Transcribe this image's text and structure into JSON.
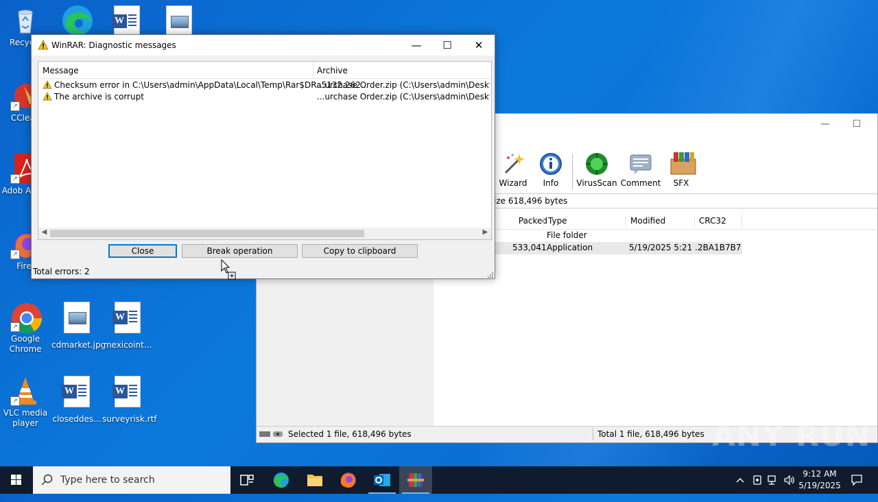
{
  "desktop": {
    "icons": [
      {
        "label": "Recycle"
      },
      {
        "label": "CClean"
      },
      {
        "label": "Adob Acrob"
      },
      {
        "label": "Firef"
      },
      {
        "label": "Google Chrome"
      },
      {
        "label": "cdmarket.jpg"
      },
      {
        "label": "mexicoint..."
      },
      {
        "label": "VLC media player"
      },
      {
        "label": "closeddes..."
      },
      {
        "label": "surveyrisk.rtf"
      }
    ]
  },
  "rar_main": {
    "toolbar": [
      {
        "label": "Wizard",
        "icon": "wizard-icon"
      },
      {
        "label": "Info",
        "icon": "info-icon"
      },
      {
        "label": "VirusScan",
        "icon": "virusscan-icon"
      },
      {
        "label": "Comment",
        "icon": "comment-icon"
      },
      {
        "label": "SFX",
        "icon": "sfx-icon"
      }
    ],
    "address_text": "ize 618,496 bytes",
    "columns": [
      "Packed",
      "Type",
      "Modified",
      "CRC32"
    ],
    "rows": [
      {
        "packed": "",
        "type": "File folder",
        "modified": "",
        "crc": ""
      },
      {
        "packed": "533,041",
        "type": "Application",
        "modified": "5/19/2025 5:21 ...",
        "crc": "2BA1B7B7"
      }
    ],
    "status_left": "Selected 1 file, 618,496 bytes",
    "status_right": "Total 1 file, 618,496 bytes"
  },
  "dialog": {
    "title": "WinRAR: Diagnostic messages",
    "columns": {
      "message": "Message",
      "archive": "Archive"
    },
    "rows": [
      {
        "message": "Checksum error in C:\\Users\\admin\\AppData\\Local\\Temp\\Rar$DRa5132.262...",
        "archive": "...urchase Order.zip (C:\\Users\\admin\\Desktop\\rebui"
      },
      {
        "message": "The archive is corrupt",
        "archive": "...urchase Order.zip (C:\\Users\\admin\\Desktop\\rebui"
      }
    ],
    "buttons": {
      "close": "Close",
      "break": "Break operation",
      "copy": "Copy to clipboard"
    },
    "status": "Total errors: 2"
  },
  "taskbar": {
    "search_placeholder": "Type here to search",
    "clock_time": "9:12 AM",
    "clock_date": "5/19/2025"
  },
  "watermark": "ANY RUN"
}
